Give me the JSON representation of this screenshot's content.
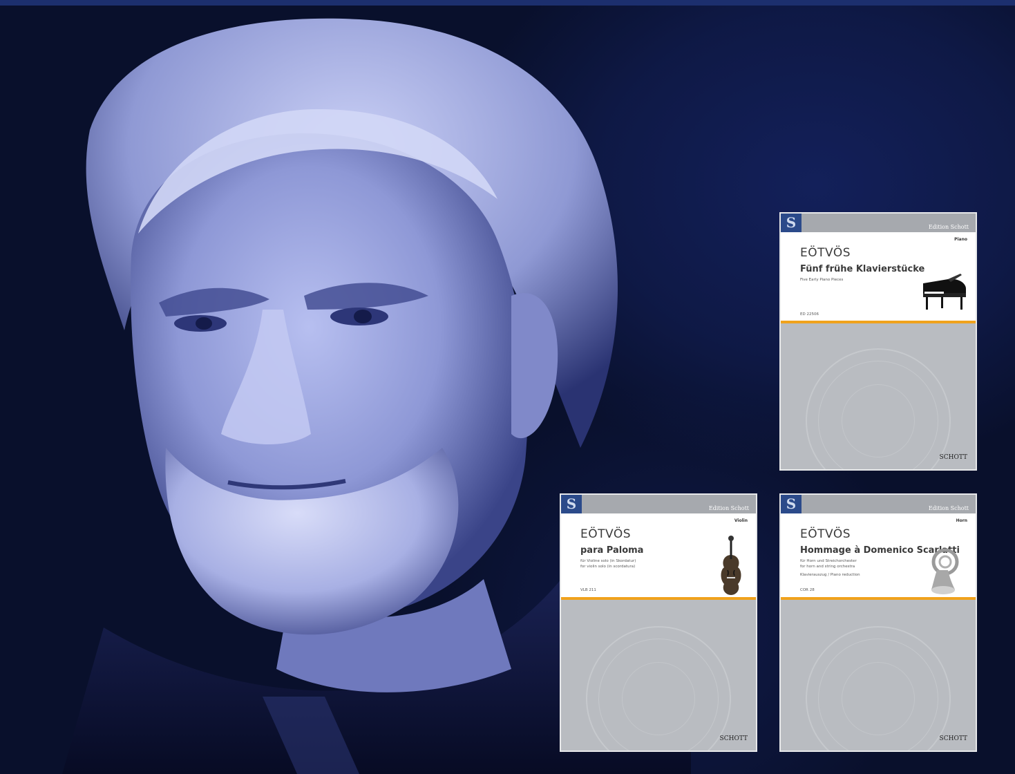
{
  "colors": {
    "background": "#09102c",
    "top_bar": "#1c2f6e",
    "photo_tint": "#aab2e8",
    "cover_grey": "#b9bcc1",
    "cover_accent": "#f0a21c",
    "logo_blue": "#2b4a8a"
  },
  "portrait": {
    "icon": "composer-portrait-photo"
  },
  "covers": [
    {
      "edition": "Edition Schott",
      "instrument": "Piano",
      "composer": "EÖTVÖS",
      "title": "Fünf frühe Klavierstücke",
      "subtitle": "Five Early Piano Pieces",
      "extra": "",
      "catalog": "ED 22506",
      "instrument_icon": "grand-piano-icon",
      "publisher": "SCHOTT"
    },
    {
      "edition": "Edition Schott",
      "instrument": "Violin",
      "composer": "EÖTVÖS",
      "title": "para Paloma",
      "subtitle": "für Violine solo (in Skordatur)\nfor violin solo (in scordatura)",
      "extra": "",
      "catalog": "VLB 211",
      "instrument_icon": "violin-icon",
      "publisher": "SCHOTT"
    },
    {
      "edition": "Edition Schott",
      "instrument": "Horn",
      "composer": "EÖTVÖS",
      "title": "Hommage à Domenico Scarlatti",
      "subtitle": "für Horn und Streichorchester\nfor horn and string orchestra",
      "extra": "Klavierauszug / Piano reduction",
      "catalog": "COR 28",
      "instrument_icon": "french-horn-icon",
      "publisher": "SCHOTT"
    }
  ]
}
